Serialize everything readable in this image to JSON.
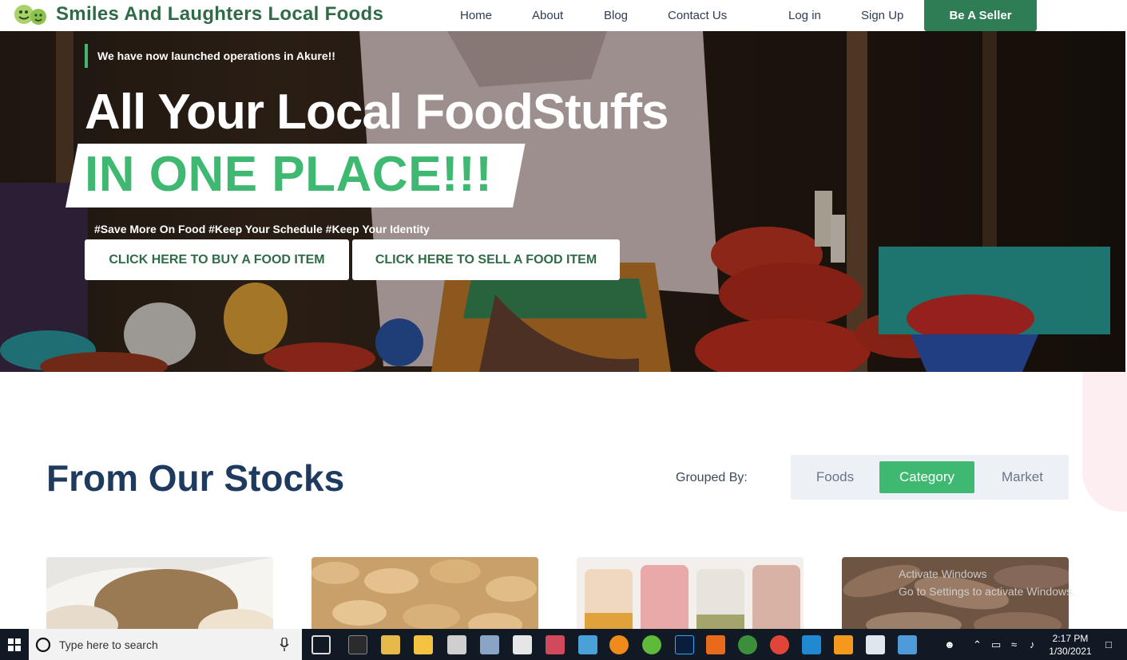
{
  "nav": {
    "brand": "Smiles And Laughters Local Foods",
    "links": [
      "Home",
      "About",
      "Blog",
      "Contact Us",
      "Log in",
      "Sign Up"
    ],
    "seller_button": "Be A Seller"
  },
  "hero": {
    "announcement": "We have now launched operations in Akure!!",
    "headline_line1": "All Your Local FoodStuffs",
    "headline_line2": "IN ONE PLACE!!!",
    "tags": "#Save More On Food #Keep Your Schedule #Keep Your Identity",
    "buy_button": "CLICK HERE TO BUY A FOOD ITEM",
    "sell_button": "CLICK HERE TO SELL A FOOD ITEM"
  },
  "stocks": {
    "title": "From Our Stocks",
    "grouped_label": "Grouped By:",
    "group_options": [
      "Foods",
      "Category",
      "Market"
    ],
    "active_option": "Category"
  },
  "watermark": {
    "line1": "Activate Windows",
    "line2": "Go to Settings to activate Windows."
  },
  "taskbar": {
    "search_placeholder": "Type here to search",
    "time": "2:17 PM",
    "date": "1/30/2021"
  },
  "colors": {
    "brand_green": "#2f6b46",
    "accent_green": "#3fb971",
    "seller_button": "#2e7d54",
    "title_navy": "#1e3a5f"
  }
}
